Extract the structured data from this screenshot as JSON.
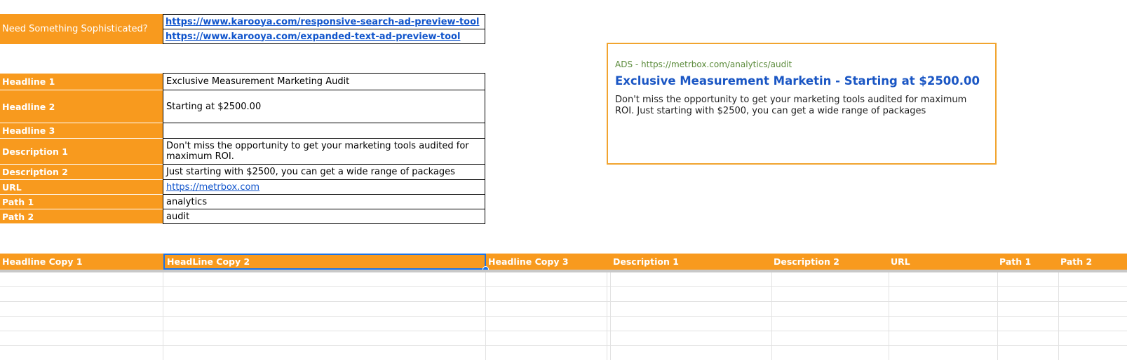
{
  "need": {
    "label": "Need Something Sophisticated?",
    "links": [
      "https://www.karooya.com/responsive-search-ad-preview-tool",
      "https://www.karooya.com/expanded-text-ad-preview-tool"
    ]
  },
  "ad_fields": [
    {
      "label": "Headline 1",
      "value": "Exclusive Measurement Marketing Audit"
    },
    {
      "label": "Headline 2",
      "value": "Starting at $2500.00"
    },
    {
      "label": "Headline 3",
      "value": ""
    },
    {
      "label": "Description 1",
      "value": "Don't miss the opportunity to get your marketing tools audited for maximum ROI."
    },
    {
      "label": "Description 2",
      "value": "Just starting with $2500, you can get a wide range of packages"
    },
    {
      "label": "URL",
      "value": "https://metrbox.com"
    },
    {
      "label": "Path 1",
      "value": "analytics"
    },
    {
      "label": "Path 2",
      "value": "audit"
    }
  ],
  "preview": {
    "display_url": "ADS - https://metrbox.com/analytics/audit",
    "title": "Exclusive Measurement Marketin - Starting at $2500.00",
    "description": "Don't miss the opportunity to get your marketing tools audited for maximum ROI. Just starting with $2500, you can get a wide range of packages"
  },
  "copy_columns": [
    "Headline Copy 1",
    "HeadLine Copy 2",
    "Headline Copy 3",
    "Description 1",
    "Description 2",
    "URL",
    "Path 1",
    "Path 2"
  ],
  "colors": {
    "header_orange": "#f89a1e",
    "link_blue": "#1155cc",
    "preview_title_blue": "#1a56c4",
    "preview_url_green": "#5a8a3a",
    "preview_border": "#f1a42f",
    "selection_blue": "#1a73e8"
  }
}
